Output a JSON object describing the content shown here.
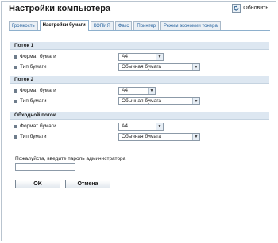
{
  "header": {
    "title": "Настройки компьютера",
    "refresh_label": "Обновить"
  },
  "tabs": [
    {
      "label": "Громкость",
      "active": false
    },
    {
      "label": "Настройки бумаги",
      "active": true
    },
    {
      "label": "КОПИЯ",
      "active": false
    },
    {
      "label": "Факс",
      "active": false
    },
    {
      "label": "Принтер",
      "active": false
    },
    {
      "label": "Режим экономии тонера",
      "active": false
    }
  ],
  "sections": [
    {
      "title": "Поток 1",
      "paper_size_label": "Формат бумаги",
      "paper_size_value": "A4",
      "paper_type_label": "Тип бумаги",
      "paper_type_value": "Обычная бумага"
    },
    {
      "title": "Поток 2",
      "paper_size_label": "Формат бумаги",
      "paper_size_value": "A4",
      "paper_type_label": "Тип бумаги",
      "paper_type_value": "Обычная бумага"
    },
    {
      "title": "Обходной поток",
      "paper_size_label": "Формат бумаги",
      "paper_size_value": "A4",
      "paper_type_label": "Тип бумаги",
      "paper_type_value": "Обычная бумага"
    }
  ],
  "password": {
    "label": "Пожалуйста, введите пароль администратора",
    "value": ""
  },
  "buttons": {
    "ok_label": "OK",
    "cancel_label": "Отмена"
  },
  "icons": {
    "refresh": "refresh-icon",
    "bullet": "bullet-square-icon",
    "dropdown": "chevron-down-icon"
  }
}
